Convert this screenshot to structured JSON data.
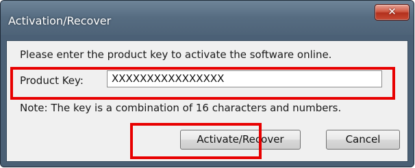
{
  "window": {
    "title": "Activation/Recover",
    "close_glyph": "✕",
    "close_icon": "close-icon"
  },
  "dialog": {
    "prompt": "Please enter the product key to activate the software online.",
    "product_key_label": "Product Key:",
    "product_key_value": "XXXXXXXXXXXXXXXX",
    "note": "Note: The key is a combination of 16 characters and numbers."
  },
  "buttons": {
    "activate_label": "Activate/Recover",
    "cancel_label": "Cancel"
  },
  "colors": {
    "highlight": "#e80000",
    "titlebar": "#566c81",
    "client_background": "#f0f0f0"
  }
}
